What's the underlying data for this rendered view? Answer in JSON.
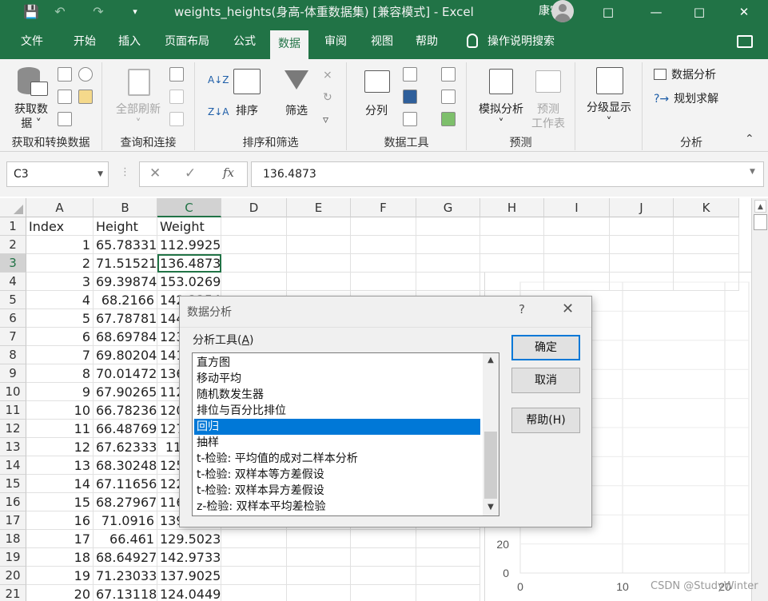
{
  "window": {
    "title": "weights_heights(身高-体重数据集)  [兼容模式]  -  Excel",
    "user": "康宇"
  },
  "menu": {
    "tabs": [
      "文件",
      "开始",
      "插入",
      "页面布局",
      "公式",
      "数据",
      "审阅",
      "视图",
      "帮助"
    ],
    "active_tab": "数据",
    "tell_me": "操作说明搜索"
  },
  "ribbon": {
    "get_transform": {
      "get_data": "获取数",
      "get_data_2": "据",
      "label": "获取和转换数据"
    },
    "queries": {
      "refresh_all": "全部刷新",
      "label": "查询和连接"
    },
    "sort_filter": {
      "sort": "排序",
      "filter": "筛选",
      "label": "排序和筛选"
    },
    "data_tools": {
      "text_to_columns": "分列",
      "label": "数据工具"
    },
    "forecast": {
      "what_if": "模拟分析",
      "forecast_sheet": "预测",
      "forecast_sheet_2": "工作表",
      "label": "预测"
    },
    "outline": {
      "group": "分级显示"
    },
    "analysis": {
      "data_analysis": "数据分析",
      "solver": "规划求解",
      "label": "分析"
    }
  },
  "formula_bar": {
    "name_box": "C3",
    "fx": "fx",
    "value": "136.4873"
  },
  "sheet": {
    "columns": [
      "A",
      "B",
      "C",
      "D",
      "E",
      "F",
      "G",
      "H",
      "I",
      "J",
      "K"
    ],
    "header_row": [
      "Index",
      "Height",
      "Weight"
    ],
    "rows": [
      [
        "1",
        "65.78331",
        "112.9925"
      ],
      [
        "2",
        "71.51521",
        "136.4873"
      ],
      [
        "3",
        "69.39874",
        "153.0269"
      ],
      [
        "4",
        "68.2166",
        "142.3354"
      ],
      [
        "5",
        "67.78781",
        "144.2971"
      ],
      [
        "6",
        "68.69784",
        "123.3024"
      ],
      [
        "7",
        "69.80204",
        "141.4947"
      ],
      [
        "8",
        "70.01472",
        "136.4623"
      ],
      [
        "9",
        "67.90265",
        "112.3723"
      ],
      [
        "10",
        "66.78236",
        "120.6672"
      ],
      [
        "11",
        "66.48769",
        "127.4516"
      ],
      [
        "12",
        "67.62333",
        "114.143"
      ],
      [
        "13",
        "68.30248",
        "125.6107"
      ],
      [
        "14",
        "67.11656",
        "122.4618"
      ],
      [
        "15",
        "68.27967",
        "116.0866"
      ],
      [
        "16",
        "71.0916",
        "139.9975"
      ],
      [
        "17",
        "66.461",
        "129.5023"
      ],
      [
        "18",
        "68.64927",
        "142.9733"
      ],
      [
        "19",
        "71.23033",
        "137.9025"
      ],
      [
        "20",
        "67.13118",
        "124.0449"
      ]
    ],
    "row_numbers": [
      "1",
      "2",
      "3",
      "4",
      "5",
      "6",
      "7",
      "8",
      "9",
      "10",
      "11",
      "12",
      "13",
      "14",
      "15",
      "16",
      "17",
      "18",
      "19",
      "20",
      "21"
    ]
  },
  "chart": {
    "y_ticks": [
      "20",
      "0"
    ],
    "x_ticks": [
      "0",
      "10",
      "20"
    ]
  },
  "dialog": {
    "title": "数据分析",
    "help_glyph": "?",
    "close_glyph": "✕",
    "tools_label": "分析工具",
    "tools_label_key": "A",
    "items": [
      "直方图",
      "移动平均",
      "随机数发生器",
      "排位与百分比排位",
      "回归",
      "抽样",
      "t-检验: 平均值的成对二样本分析",
      "t-检验: 双样本等方差假设",
      "t-检验: 双样本异方差假设",
      "z-检验: 双样本平均差检验"
    ],
    "selected_index": 4,
    "ok": "确定",
    "cancel": "取消",
    "help": "帮助(H)"
  },
  "watermark": "CSDN @StudyWinter",
  "colors": {
    "accent": "#217346",
    "selection": "#0078d7"
  }
}
